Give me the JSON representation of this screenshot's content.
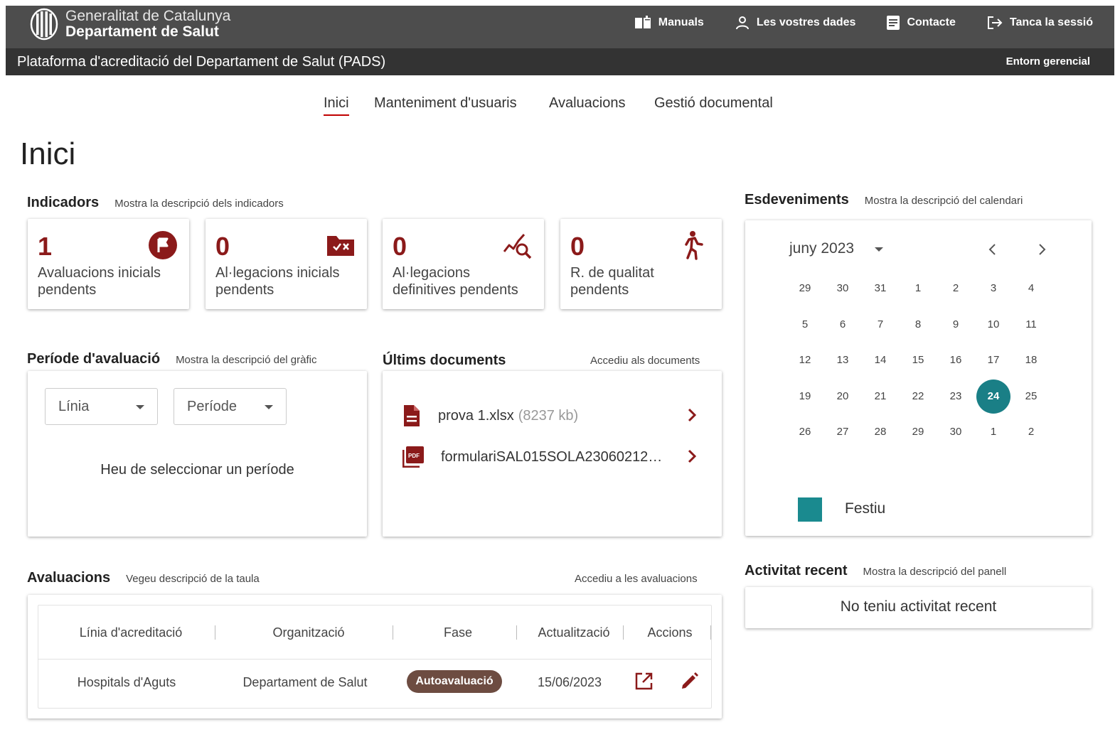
{
  "header": {
    "org_line1": "Generalitat de Catalunya",
    "org_line2": "Departament de Salut",
    "nav": {
      "manuals": "Manuals",
      "dades": "Les vostres dades",
      "contacte": "Contacte",
      "logout": "Tanca la sessió"
    }
  },
  "subheader": {
    "title": "Plataforma d'acreditació del Departament de Salut (PADS)",
    "environment": "Entorn gerencial"
  },
  "main_nav": {
    "inici": "Inici",
    "usuaris": "Manteniment d'usuaris",
    "avaluacions": "Avaluacions",
    "gestio": "Gestió documental",
    "active": "inici"
  },
  "page_title": "Inici",
  "indicadors": {
    "title": "Indicadors",
    "desc_link": "Mostra la descripció dels indicadors",
    "items": [
      {
        "value": "1",
        "label": "Avaluacions inicials pendents",
        "icon": "flag-circle-icon"
      },
      {
        "value": "0",
        "label": "Al·legacions inicials pendents",
        "icon": "folder-x-icon"
      },
      {
        "value": "0",
        "label": "Al·legacions definitives pendents",
        "icon": "chart-search-icon"
      },
      {
        "value": "0",
        "label": "R. de qualitat pendents",
        "icon": "person-walk-icon"
      }
    ]
  },
  "periode": {
    "title": "Període d'avaluació",
    "desc_link": "Mostra la descripció del gràfic",
    "select_linia": "Línia",
    "select_periode": "Període",
    "empty_msg": "Heu de seleccionar un període"
  },
  "documents": {
    "title": "Últims documents",
    "link": "Accediu als documents",
    "items": [
      {
        "name": "prova 1.xlsx",
        "size": "(8237 kb)",
        "icon": "file-document-icon"
      },
      {
        "name": "formulariSAL015SOLA23060212…",
        "size": "",
        "icon": "pdf-file-icon"
      }
    ]
  },
  "calendar": {
    "title": "Esdeveniments",
    "desc_link": "Mostra la descripció del calendari",
    "month": "juny 2023",
    "weeks": [
      [
        "29",
        "30",
        "31",
        "1",
        "2",
        "3",
        "4"
      ],
      [
        "5",
        "6",
        "7",
        "8",
        "9",
        "10",
        "11"
      ],
      [
        "12",
        "13",
        "14",
        "15",
        "16",
        "17",
        "18"
      ],
      [
        "19",
        "20",
        "21",
        "22",
        "23",
        "24",
        "25"
      ],
      [
        "26",
        "27",
        "28",
        "29",
        "30",
        "1",
        "2"
      ]
    ],
    "selected_day": "24",
    "legend_label": "Festiu",
    "legend_color": "#1a8a8f"
  },
  "activitat": {
    "title": "Activitat recent",
    "desc_link": "Mostra la descripció del panell",
    "empty_msg": "No teniu activitat recent"
  },
  "avaluacions": {
    "title": "Avaluacions",
    "desc_link": "Vegeu descripció de la taula",
    "link": "Accediu a les avaluacions",
    "columns": [
      "Línia d'acreditació",
      "Organització",
      "Fase",
      "Actualització",
      "Accions"
    ],
    "rows": [
      {
        "linia": "Hospitals d'Aguts",
        "org": "Departament de Salut",
        "fase": "Autoavaluació",
        "data": "15/06/2023"
      }
    ]
  },
  "colors": {
    "accent": "#8b1a1a",
    "topbar": "#4d4d4d",
    "subbar": "#333333",
    "calendar_selected": "#1a7f86",
    "badge": "#6d4c41"
  }
}
